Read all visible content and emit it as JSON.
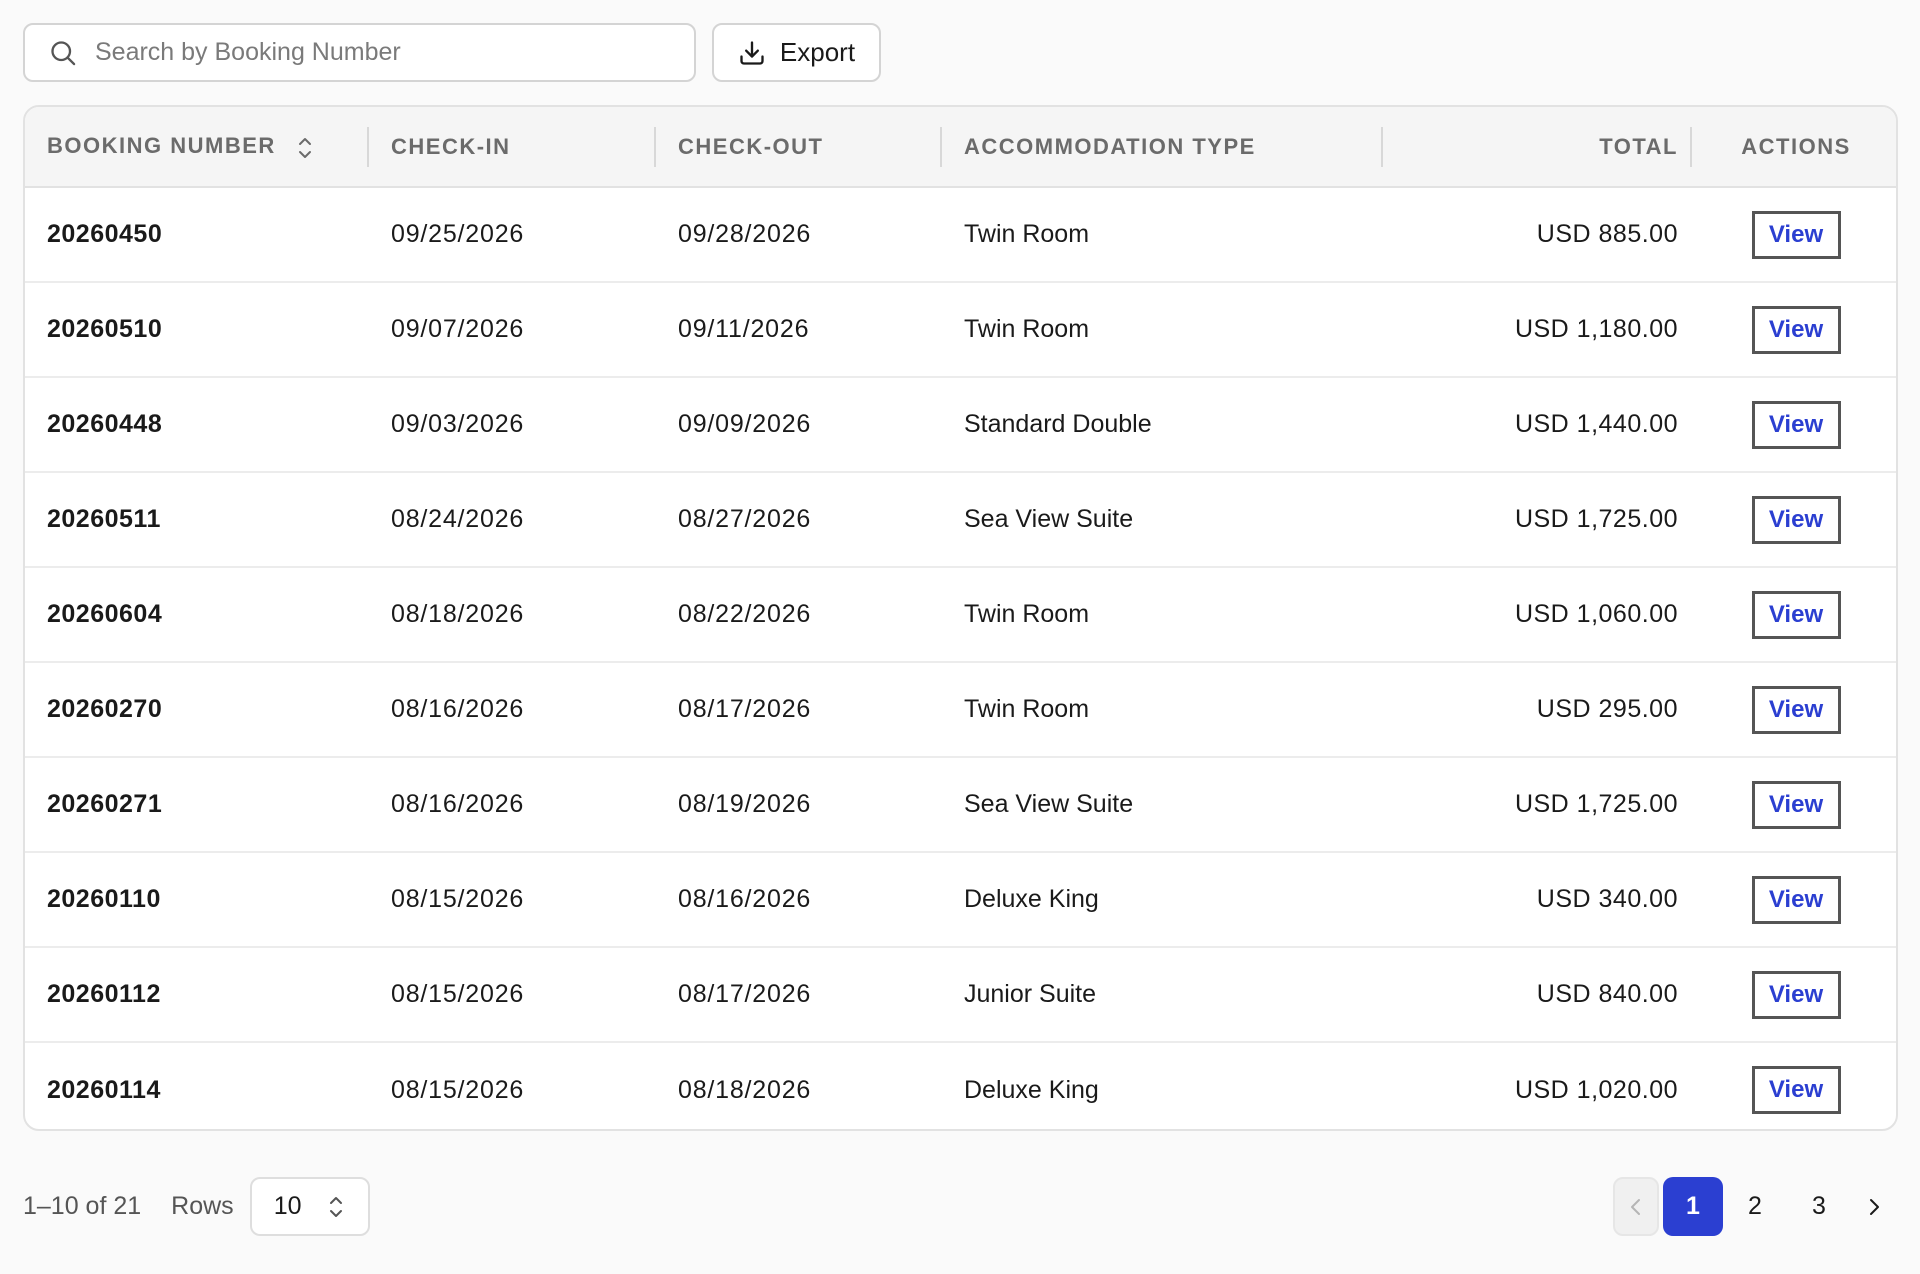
{
  "search": {
    "placeholder": "Search by Booking Number",
    "value": ""
  },
  "toolbar": {
    "export_label": "Export"
  },
  "table": {
    "headers": {
      "booking_number": "BOOKING NUMBER",
      "check_in": "CHECK-IN",
      "check_out": "CHECK-OUT",
      "accommodation_type": "ACCOMMODATION TYPE",
      "total": "TOTAL",
      "actions": "ACTIONS"
    },
    "view_label": "View",
    "rows": [
      {
        "booking_number": "20260450",
        "check_in": "09/25/2026",
        "check_out": "09/28/2026",
        "type": "Twin Room",
        "total": "USD 885.00"
      },
      {
        "booking_number": "20260510",
        "check_in": "09/07/2026",
        "check_out": "09/11/2026",
        "type": "Twin Room",
        "total": "USD 1,180.00"
      },
      {
        "booking_number": "20260448",
        "check_in": "09/03/2026",
        "check_out": "09/09/2026",
        "type": "Standard Double",
        "total": "USD 1,440.00"
      },
      {
        "booking_number": "20260511",
        "check_in": "08/24/2026",
        "check_out": "08/27/2026",
        "type": "Sea View Suite",
        "total": "USD 1,725.00"
      },
      {
        "booking_number": "20260604",
        "check_in": "08/18/2026",
        "check_out": "08/22/2026",
        "type": "Twin Room",
        "total": "USD 1,060.00"
      },
      {
        "booking_number": "20260270",
        "check_in": "08/16/2026",
        "check_out": "08/17/2026",
        "type": "Twin Room",
        "total": "USD 295.00"
      },
      {
        "booking_number": "20260271",
        "check_in": "08/16/2026",
        "check_out": "08/19/2026",
        "type": "Sea View Suite",
        "total": "USD 1,725.00"
      },
      {
        "booking_number": "20260110",
        "check_in": "08/15/2026",
        "check_out": "08/16/2026",
        "type": "Deluxe King",
        "total": "USD 340.00"
      },
      {
        "booking_number": "20260112",
        "check_in": "08/15/2026",
        "check_out": "08/17/2026",
        "type": "Junior Suite",
        "total": "USD 840.00"
      },
      {
        "booking_number": "20260114",
        "check_in": "08/15/2026",
        "check_out": "08/18/2026",
        "type": "Deluxe King",
        "total": "USD 1,020.00"
      }
    ]
  },
  "footer": {
    "range_text": "1–10 of 21",
    "rows_label": "Rows",
    "rows_value": "10",
    "pages": [
      "1",
      "2",
      "3"
    ],
    "current_page": "1"
  },
  "colors": {
    "accent": "#2b3fd1",
    "border": "#d4d4d4",
    "header_bg": "#f5f5f5"
  },
  "icons": {
    "search": "search-icon",
    "export": "download-icon",
    "sort": "sort-icon",
    "rows_select": "chevron-up-down-icon",
    "prev": "chevron-left-icon",
    "next": "chevron-right-icon"
  }
}
